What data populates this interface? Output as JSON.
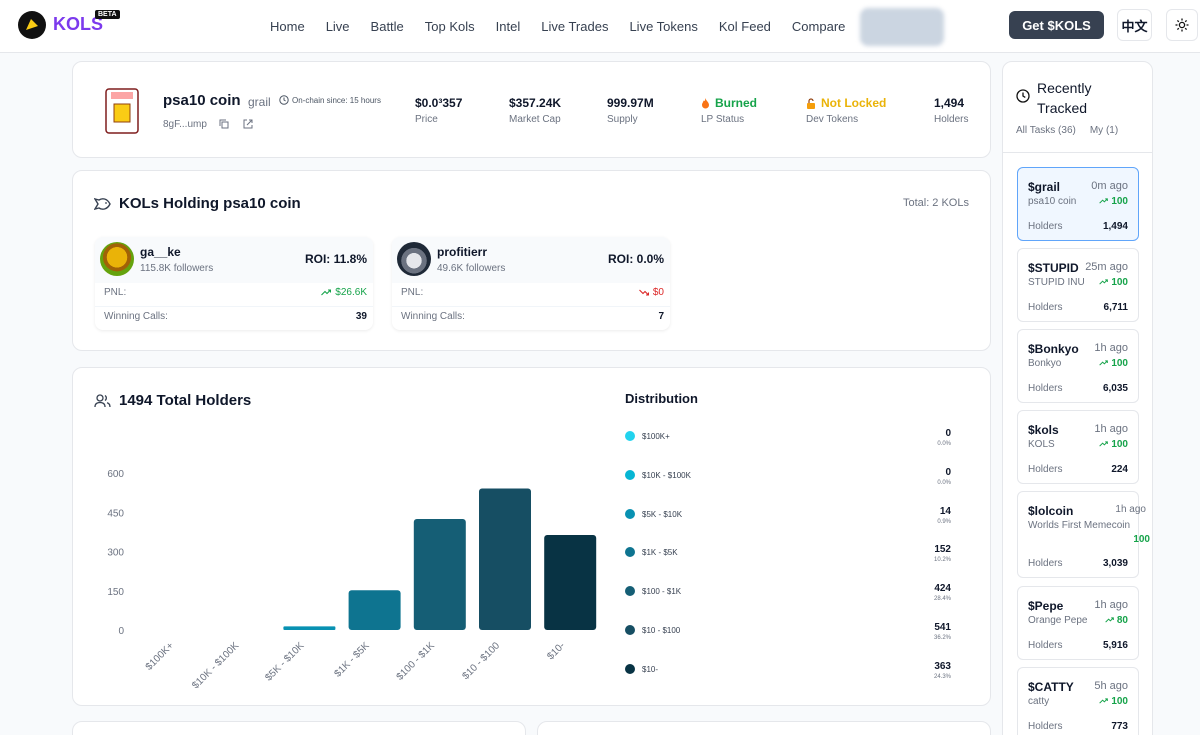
{
  "nav": {
    "brand": "KOLS",
    "beta": "BETA",
    "links": [
      "Home",
      "Live",
      "Battle",
      "Top Kols",
      "Intel",
      "Live Trades",
      "Live Tokens",
      "Kol Feed",
      "Compare"
    ],
    "cta": "Get $KOLS",
    "lang": "中文"
  },
  "token": {
    "name": "psa10 coin",
    "symbol": "grail",
    "since": "On-chain since: 15 hours",
    "address": "8gF...ump",
    "stats": [
      {
        "value": "$0.0³357",
        "label": "Price"
      },
      {
        "value": "$357.24K",
        "label": "Market Cap"
      },
      {
        "value": "999.97M",
        "label": "Supply"
      },
      {
        "value": "Burned",
        "label": "LP Status",
        "color": "#16a34a"
      },
      {
        "value": "Not Locked",
        "label": "Dev Tokens",
        "color": "#eab308"
      },
      {
        "value": "1,494",
        "label": "Holders"
      }
    ]
  },
  "kols": {
    "title": "KOLs Holding psa10 coin",
    "total": "Total: 2 KOLs",
    "pnl_label": "PNL:",
    "calls_label": "Winning Calls:",
    "items": [
      {
        "name": "ga__ke",
        "followers": "115.8K followers",
        "roi": "ROI: 11.8%",
        "pnl": "$26.6K",
        "calls": "39"
      },
      {
        "name": "profitierr",
        "followers": "49.6K followers",
        "roi": "ROI: 0.0%",
        "pnl": "$0",
        "calls": "7"
      }
    ]
  },
  "holders": {
    "title": "1494 Total Holders",
    "dist_title": "Distribution",
    "dist": [
      {
        "label": "$100K+",
        "count": "0",
        "pct": "0.0%",
        "color": "#22d3ee"
      },
      {
        "label": "$10K - $100K",
        "count": "0",
        "pct": "0.0%",
        "color": "#06b6d4"
      },
      {
        "label": "$5K - $10K",
        "count": "14",
        "pct": "0.9%",
        "color": "#0891b2"
      },
      {
        "label": "$1K - $5K",
        "count": "152",
        "pct": "10.2%",
        "color": "#0e7490"
      },
      {
        "label": "$100 - $1K",
        "count": "424",
        "pct": "28.4%",
        "color": "#155e75"
      },
      {
        "label": "$10 - $100",
        "count": "541",
        "pct": "36.2%",
        "color": "#164e63"
      },
      {
        "label": "$10-",
        "count": "363",
        "pct": "24.3%",
        "color": "#083344"
      }
    ]
  },
  "chart_data": {
    "type": "bar",
    "categories": [
      "$100K+",
      "$10K - $100K",
      "$5K - $10K",
      "$1K - $5K",
      "$100 - $1K",
      "$10 - $100",
      "$10-"
    ],
    "values": [
      0,
      0,
      14,
      152,
      424,
      541,
      363
    ],
    "colors": [
      "#22d3ee",
      "#06b6d4",
      "#0891b2",
      "#0e7490",
      "#155e75",
      "#164e63",
      "#083344"
    ],
    "yticks": [
      0,
      150,
      300,
      450,
      600
    ],
    "ylim": [
      0,
      600
    ],
    "grid": false
  },
  "sidebar": {
    "title": "Recently Tracked",
    "tabs": [
      "All Tasks (36)",
      "My (1)"
    ],
    "holders_label": "Holders",
    "items": [
      {
        "symbol": "$grail",
        "ago": "0m ago",
        "name": "psa10 coin",
        "score": "100",
        "holders": "1,494",
        "active": true
      },
      {
        "symbol": "$STUPID",
        "ago": "25m ago",
        "name": "STUPID INU",
        "score": "100",
        "holders": "6,711"
      },
      {
        "symbol": "$Bonkyo",
        "ago": "1h ago",
        "name": "Bonkyo",
        "score": "100",
        "holders": "6,035"
      },
      {
        "symbol": "$kols",
        "ago": "1h ago",
        "name": "KOLS",
        "score": "100",
        "holders": "224"
      },
      {
        "symbol": "$lolcoin",
        "ago": "1h ago",
        "name": "Worlds First Memecoin",
        "score": "100",
        "holders": "3,039"
      },
      {
        "symbol": "$Pepe",
        "ago": "1h ago",
        "name": "Orange Pepe",
        "score": "80",
        "holders": "5,916"
      },
      {
        "symbol": "$CATTY",
        "ago": "5h ago",
        "name": "catty",
        "score": "100",
        "holders": "773"
      }
    ]
  }
}
